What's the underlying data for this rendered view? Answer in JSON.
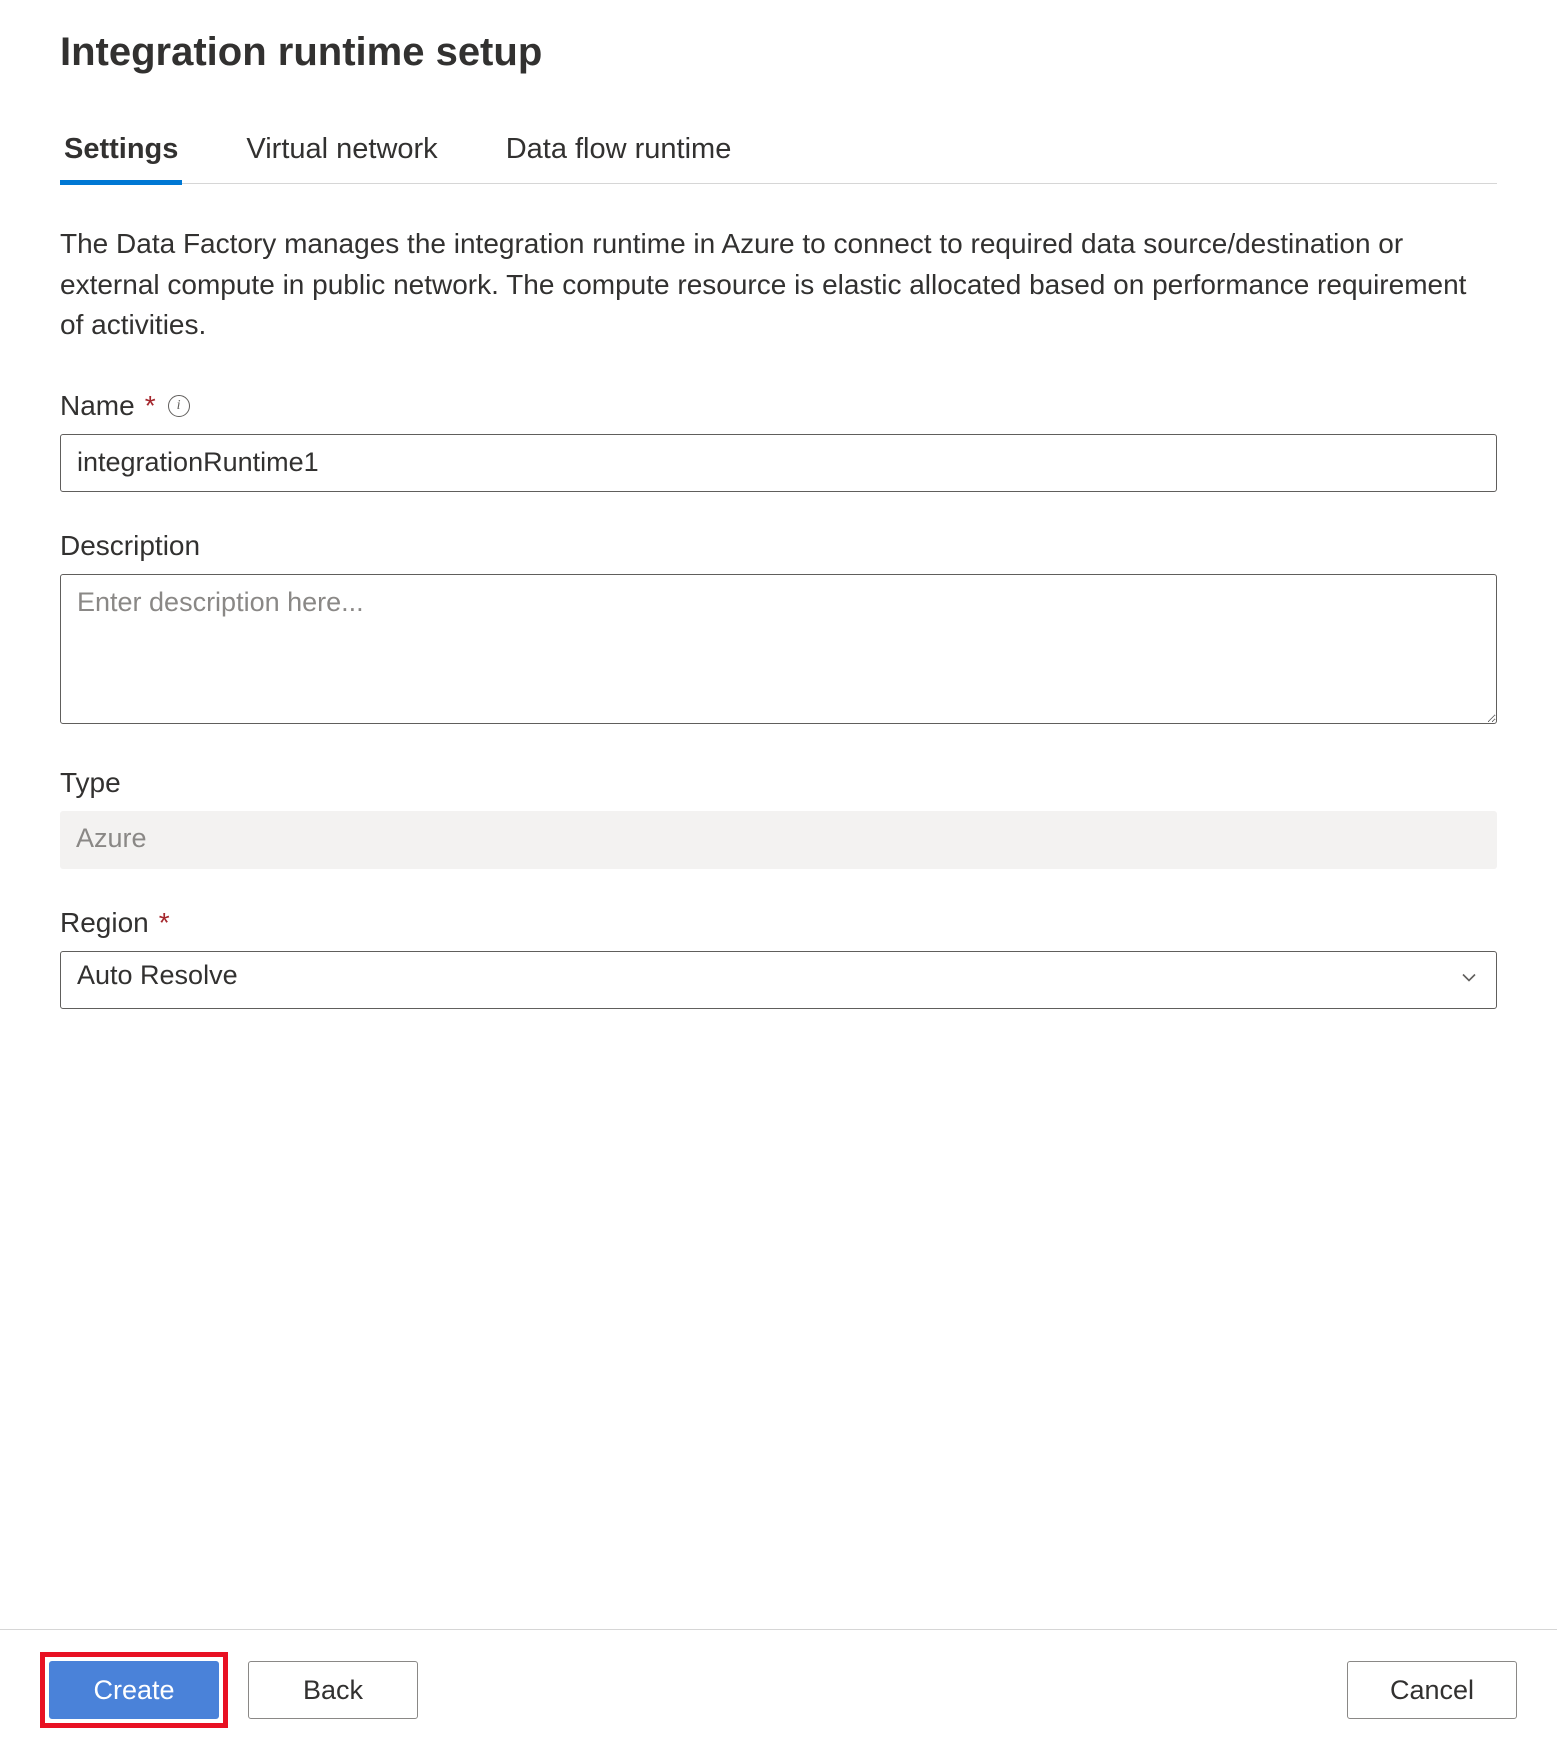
{
  "title": "Integration runtime setup",
  "tabs": [
    {
      "label": "Settings"
    },
    {
      "label": "Virtual network"
    },
    {
      "label": "Data flow runtime"
    }
  ],
  "intro": "The Data Factory manages the integration runtime in Azure to connect to required data source/destination or external compute in public network. The compute resource is elastic allocated based on performance requirement of activities.",
  "fields": {
    "name": {
      "label": "Name",
      "value": "integrationRuntime1"
    },
    "description": {
      "label": "Description",
      "placeholder": "Enter description here..."
    },
    "type": {
      "label": "Type",
      "value": "Azure"
    },
    "region": {
      "label": "Region",
      "value": "Auto Resolve"
    }
  },
  "footer": {
    "create": "Create",
    "back": "Back",
    "cancel": "Cancel"
  }
}
